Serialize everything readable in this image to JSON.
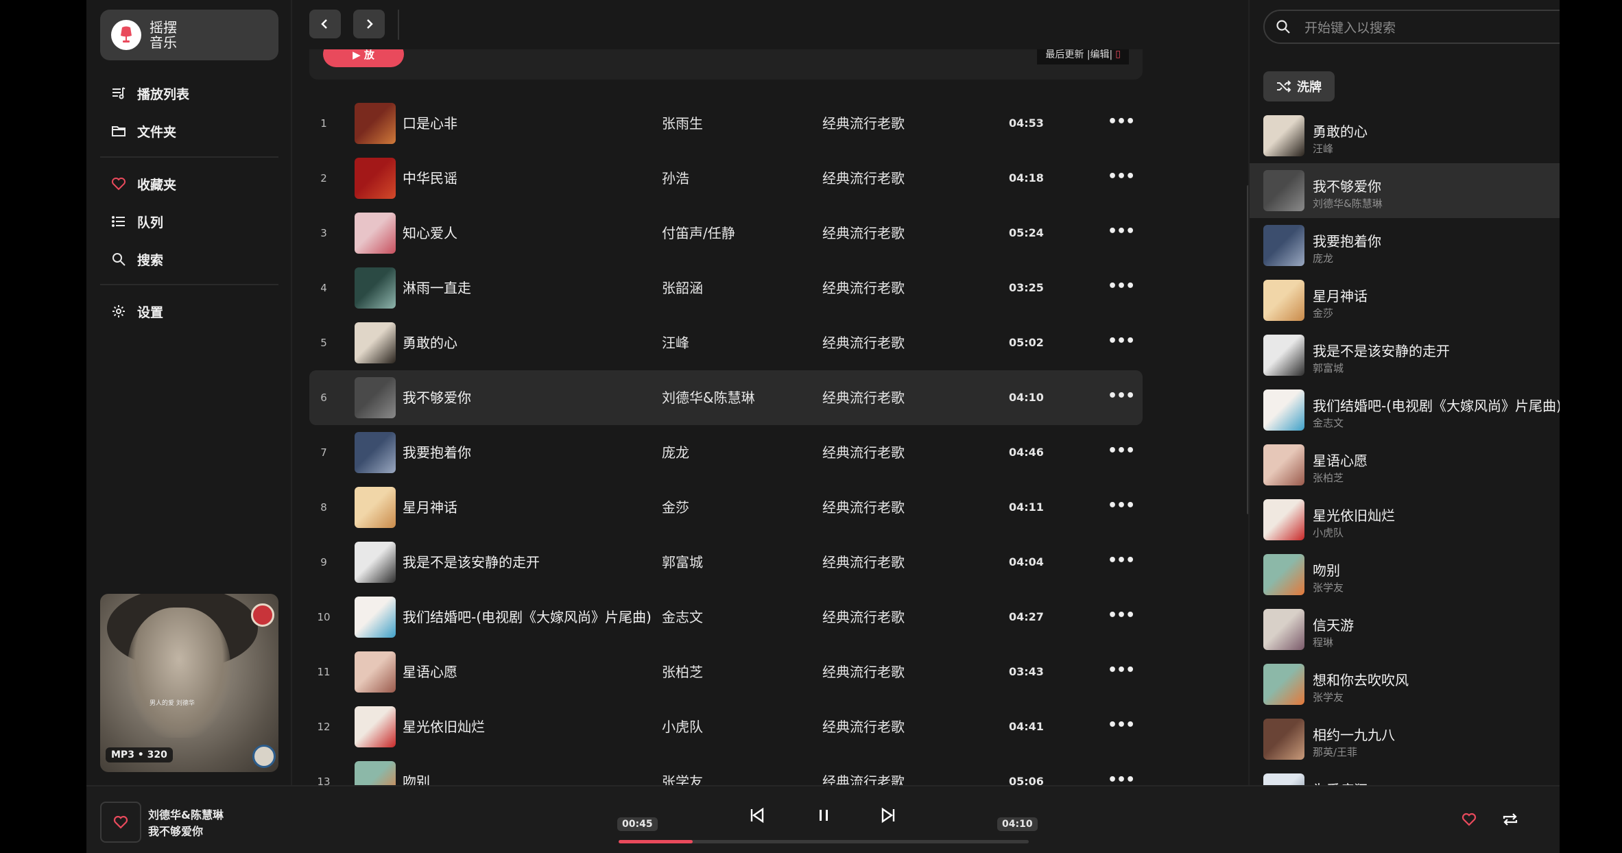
{
  "app": {
    "brand_line1": "摇摆",
    "brand_line2": "音乐",
    "accent": "#e94a5c"
  },
  "sidebar": {
    "items": [
      {
        "label": "播放列表",
        "icon": "playlist-icon"
      },
      {
        "label": "文件夹",
        "icon": "folder-icon"
      },
      {
        "label": "收藏夹",
        "icon": "heart-icon"
      },
      {
        "label": "队列",
        "icon": "queue-icon"
      },
      {
        "label": "搜索",
        "icon": "search-icon"
      },
      {
        "label": "设置",
        "icon": "gear-icon"
      }
    ],
    "cover_badge": "MP3 • 320",
    "cover_caption": "男人的爱 刘德华"
  },
  "main": {
    "play_label": "▶ 放",
    "last_update": "最后更新 |编辑|",
    "tracks": [
      {
        "n": "1",
        "title": "口是心非",
        "artist": "张雨生",
        "album": "经典流行老歌",
        "dur": "04:53",
        "c1": "#7a2a1e",
        "c2": "#d07a3a"
      },
      {
        "n": "2",
        "title": "中华民谣",
        "artist": "孙浩",
        "album": "经典流行老歌",
        "dur": "04:18",
        "c1": "#a31818",
        "c2": "#d34a2a"
      },
      {
        "n": "3",
        "title": "知心爱人",
        "artist": "付笛声/任静",
        "album": "经典流行老歌",
        "dur": "05:24",
        "c1": "#e8c4c8",
        "c2": "#c7505e"
      },
      {
        "n": "4",
        "title": "淋雨一直走",
        "artist": "张韶涵",
        "album": "经典流行老歌",
        "dur": "03:25",
        "c1": "#2b4a44",
        "c2": "#8fb5ad"
      },
      {
        "n": "5",
        "title": "勇敢的心",
        "artist": "汪峰",
        "album": "经典流行老歌",
        "dur": "05:02",
        "c1": "#e0d6c8",
        "c2": "#2a241e"
      },
      {
        "n": "6",
        "title": "我不够爱你",
        "artist": "刘德华&陈慧琳",
        "album": "经典流行老歌",
        "dur": "04:10",
        "c1": "#4a4a4a",
        "c2": "#8a8a8a"
      },
      {
        "n": "7",
        "title": "我要抱着你",
        "artist": "庞龙",
        "album": "经典流行老歌",
        "dur": "04:46",
        "c1": "#3c4e6e",
        "c2": "#9aa8c0"
      },
      {
        "n": "8",
        "title": "星月神话",
        "artist": "金莎",
        "album": "经典流行老歌",
        "dur": "04:11",
        "c1": "#f1d6a8",
        "c2": "#c98a4a"
      },
      {
        "n": "9",
        "title": "我是不是该安静的走开",
        "artist": "郭富城",
        "album": "经典流行老歌",
        "dur": "04:04",
        "c1": "#e8e8e8",
        "c2": "#2e2e2e"
      },
      {
        "n": "10",
        "title": "我们结婚吧-(电视剧《大嫁风尚》片尾曲)",
        "artist": "金志文",
        "album": "经典流行老歌",
        "dur": "04:27",
        "c1": "#f4f0ec",
        "c2": "#3ea0c8"
      },
      {
        "n": "11",
        "title": "星语心愿",
        "artist": "张柏芝",
        "album": "经典流行老歌",
        "dur": "03:43",
        "c1": "#e6c7b8",
        "c2": "#9a5a4c"
      },
      {
        "n": "12",
        "title": "星光依旧灿烂",
        "artist": "小虎队",
        "album": "经典流行老歌",
        "dur": "04:41",
        "c1": "#f0e8e0",
        "c2": "#c82828"
      },
      {
        "n": "13",
        "title": "吻别",
        "artist": "张学友",
        "album": "经典流行老歌",
        "dur": "05:06",
        "c1": "#8cb8a8",
        "c2": "#e4783a"
      }
    ]
  },
  "queue": {
    "search_placeholder": "开始键入以搜索",
    "shuffle_label": "洗牌",
    "items": [
      {
        "title": "勇敢的心",
        "artist": "汪峰",
        "c1": "#e0d6c8",
        "c2": "#2a241e"
      },
      {
        "title": "我不够爱你",
        "artist": "刘德华&陈慧琳",
        "c1": "#4a4a4a",
        "c2": "#8a8a8a"
      },
      {
        "title": "我要抱着你",
        "artist": "庞龙",
        "c1": "#3c4e6e",
        "c2": "#9aa8c0"
      },
      {
        "title": "星月神话",
        "artist": "金莎",
        "c1": "#f1d6a8",
        "c2": "#c98a4a"
      },
      {
        "title": "我是不是该安静的走开",
        "artist": "郭富城",
        "c1": "#e8e8e8",
        "c2": "#2e2e2e"
      },
      {
        "title": "我们结婚吧-(电视剧《大嫁风尚》片尾曲)",
        "artist": "金志文",
        "c1": "#f4f0ec",
        "c2": "#3ea0c8"
      },
      {
        "title": "星语心愿",
        "artist": "张柏芝",
        "c1": "#e6c7b8",
        "c2": "#9a5a4c"
      },
      {
        "title": "星光依旧灿烂",
        "artist": "小虎队",
        "c1": "#f0e8e0",
        "c2": "#c82828"
      },
      {
        "title": "吻别",
        "artist": "张学友",
        "c1": "#8cb8a8",
        "c2": "#e4783a"
      },
      {
        "title": "信天游",
        "artist": "程琳",
        "c1": "#d8d0c8",
        "c2": "#7a5a6a"
      },
      {
        "title": "想和你去吹吹风",
        "artist": "张学友",
        "c1": "#8cb8a8",
        "c2": "#e4783a"
      },
      {
        "title": "相约一九九八",
        "artist": "那英/王菲",
        "c1": "#6a4436",
        "c2": "#c89a7a"
      },
      {
        "title": "为爱痴狂",
        "artist": "",
        "c1": "#dfe6ee",
        "c2": "#6a7a8c"
      }
    ]
  },
  "player": {
    "artist": "刘德华&陈慧琳",
    "title": "我不够爱你",
    "elapsed": "00:45",
    "total": "04:10",
    "progress_fraction": 0.18
  }
}
